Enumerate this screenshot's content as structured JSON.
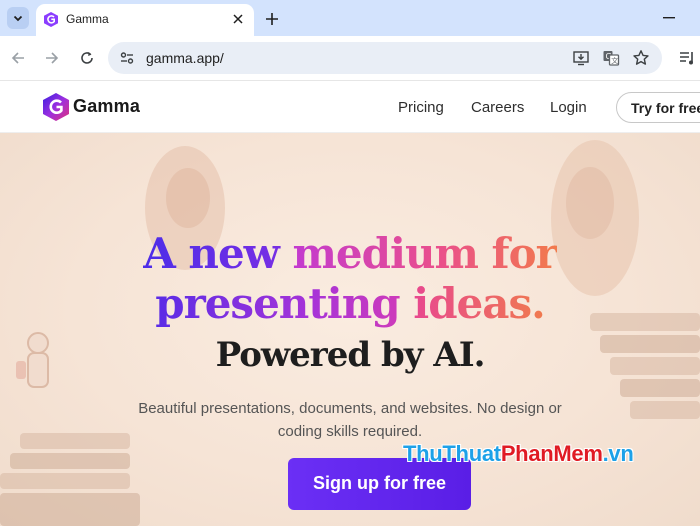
{
  "browser": {
    "tab_title": "Gamma",
    "url": "gamma.app/"
  },
  "site": {
    "brand": "Gamma",
    "nav": [
      "Pricing",
      "Careers",
      "Login"
    ],
    "try_button": "Try for free"
  },
  "hero": {
    "headline_line1_a": "A new ",
    "headline_line1_b": "medium for",
    "headline_line2_a": "presenting ",
    "headline_line2_b": "ideas.",
    "headline_line3": "Powered by AI.",
    "subtitle_line1": "Beautiful presentations, documents, and websites. No design or",
    "subtitle_line2": "coding skills required.",
    "cta": "Sign up for free"
  },
  "watermark": {
    "part1": "Thu",
    "part2": "Thuat",
    "part3": "PhanMem",
    "part4": ".vn"
  },
  "colors": {
    "accent_purple": "#6b2ff5",
    "tabbar": "#d3e3fd",
    "hero_bg": "#f6e4d6"
  }
}
